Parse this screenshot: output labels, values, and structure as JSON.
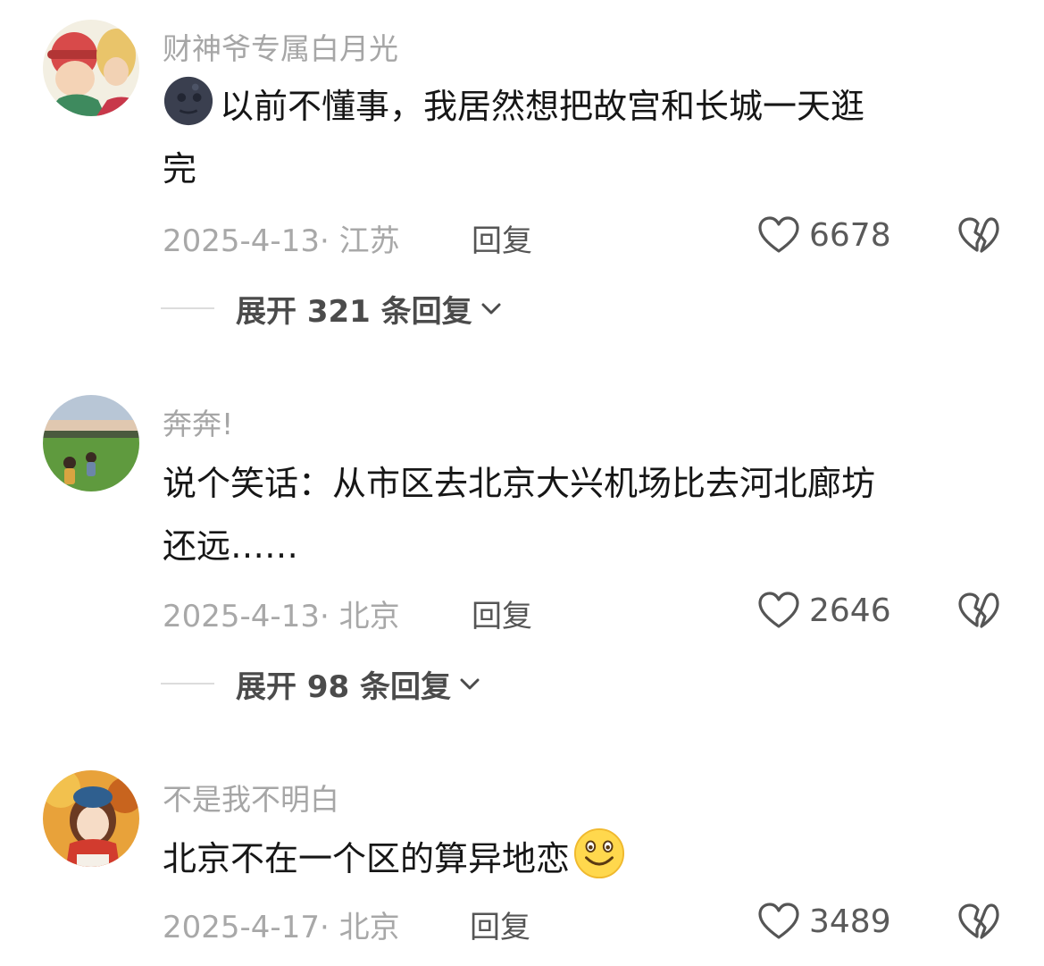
{
  "comments": [
    {
      "username": "财神爷专属白月光",
      "content_emoji": "dark-moon-face-emoji",
      "content_line1": "以前不懂事，我居然想把故宫和长城一天逛",
      "content_line2": "完",
      "meta": "2025-4-13· 江苏",
      "reply_label": "回复",
      "likes": "6678",
      "expand": "展开 321 条回复"
    },
    {
      "username": "奔奔!",
      "content_line1": "说个笑话：从市区去北京大兴机场比去河北廊坊",
      "content_line2": "还远……",
      "meta": "2025-4-13· 北京",
      "reply_label": "回复",
      "likes": "2646",
      "expand": "展开 98 条回复"
    },
    {
      "username": "不是我不明白",
      "content_line1": "北京不在一个区的算异地恋",
      "content_emoji": "grinning-face-emoji",
      "meta": "2025-4-17· 北京",
      "reply_label": "回复",
      "likes": "3489"
    }
  ],
  "icons": {
    "like": "heart-outline-icon",
    "dislike": "broken-heart-outline-icon",
    "expand": "chevron-down-icon"
  },
  "colors": {
    "username": "#a6a6a6",
    "meta": "#a8a8a8",
    "text": "#161616"
  }
}
